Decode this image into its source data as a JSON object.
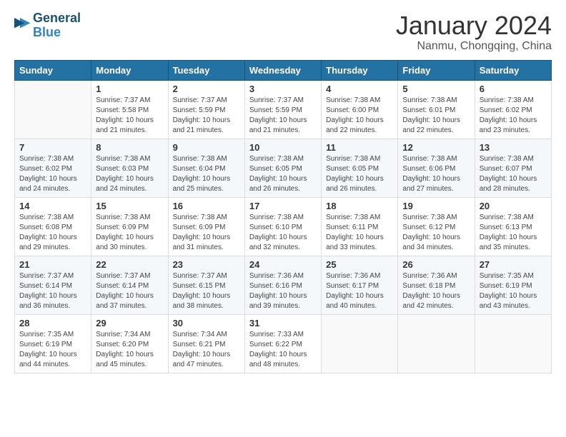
{
  "header": {
    "logo_line1": "General",
    "logo_line2": "Blue",
    "month_title": "January 2024",
    "location": "Nanmu, Chongqing, China"
  },
  "days_of_week": [
    "Sunday",
    "Monday",
    "Tuesday",
    "Wednesday",
    "Thursday",
    "Friday",
    "Saturday"
  ],
  "weeks": [
    [
      {
        "day": "",
        "info": ""
      },
      {
        "day": "1",
        "info": "Sunrise: 7:37 AM\nSunset: 5:58 PM\nDaylight: 10 hours\nand 21 minutes."
      },
      {
        "day": "2",
        "info": "Sunrise: 7:37 AM\nSunset: 5:59 PM\nDaylight: 10 hours\nand 21 minutes."
      },
      {
        "day": "3",
        "info": "Sunrise: 7:37 AM\nSunset: 5:59 PM\nDaylight: 10 hours\nand 21 minutes."
      },
      {
        "day": "4",
        "info": "Sunrise: 7:38 AM\nSunset: 6:00 PM\nDaylight: 10 hours\nand 22 minutes."
      },
      {
        "day": "5",
        "info": "Sunrise: 7:38 AM\nSunset: 6:01 PM\nDaylight: 10 hours\nand 22 minutes."
      },
      {
        "day": "6",
        "info": "Sunrise: 7:38 AM\nSunset: 6:02 PM\nDaylight: 10 hours\nand 23 minutes."
      }
    ],
    [
      {
        "day": "7",
        "info": "Sunrise: 7:38 AM\nSunset: 6:02 PM\nDaylight: 10 hours\nand 24 minutes."
      },
      {
        "day": "8",
        "info": "Sunrise: 7:38 AM\nSunset: 6:03 PM\nDaylight: 10 hours\nand 24 minutes."
      },
      {
        "day": "9",
        "info": "Sunrise: 7:38 AM\nSunset: 6:04 PM\nDaylight: 10 hours\nand 25 minutes."
      },
      {
        "day": "10",
        "info": "Sunrise: 7:38 AM\nSunset: 6:05 PM\nDaylight: 10 hours\nand 26 minutes."
      },
      {
        "day": "11",
        "info": "Sunrise: 7:38 AM\nSunset: 6:05 PM\nDaylight: 10 hours\nand 26 minutes."
      },
      {
        "day": "12",
        "info": "Sunrise: 7:38 AM\nSunset: 6:06 PM\nDaylight: 10 hours\nand 27 minutes."
      },
      {
        "day": "13",
        "info": "Sunrise: 7:38 AM\nSunset: 6:07 PM\nDaylight: 10 hours\nand 28 minutes."
      }
    ],
    [
      {
        "day": "14",
        "info": "Sunrise: 7:38 AM\nSunset: 6:08 PM\nDaylight: 10 hours\nand 29 minutes."
      },
      {
        "day": "15",
        "info": "Sunrise: 7:38 AM\nSunset: 6:09 PM\nDaylight: 10 hours\nand 30 minutes."
      },
      {
        "day": "16",
        "info": "Sunrise: 7:38 AM\nSunset: 6:09 PM\nDaylight: 10 hours\nand 31 minutes."
      },
      {
        "day": "17",
        "info": "Sunrise: 7:38 AM\nSunset: 6:10 PM\nDaylight: 10 hours\nand 32 minutes."
      },
      {
        "day": "18",
        "info": "Sunrise: 7:38 AM\nSunset: 6:11 PM\nDaylight: 10 hours\nand 33 minutes."
      },
      {
        "day": "19",
        "info": "Sunrise: 7:38 AM\nSunset: 6:12 PM\nDaylight: 10 hours\nand 34 minutes."
      },
      {
        "day": "20",
        "info": "Sunrise: 7:38 AM\nSunset: 6:13 PM\nDaylight: 10 hours\nand 35 minutes."
      }
    ],
    [
      {
        "day": "21",
        "info": "Sunrise: 7:37 AM\nSunset: 6:14 PM\nDaylight: 10 hours\nand 36 minutes."
      },
      {
        "day": "22",
        "info": "Sunrise: 7:37 AM\nSunset: 6:14 PM\nDaylight: 10 hours\nand 37 minutes."
      },
      {
        "day": "23",
        "info": "Sunrise: 7:37 AM\nSunset: 6:15 PM\nDaylight: 10 hours\nand 38 minutes."
      },
      {
        "day": "24",
        "info": "Sunrise: 7:36 AM\nSunset: 6:16 PM\nDaylight: 10 hours\nand 39 minutes."
      },
      {
        "day": "25",
        "info": "Sunrise: 7:36 AM\nSunset: 6:17 PM\nDaylight: 10 hours\nand 40 minutes."
      },
      {
        "day": "26",
        "info": "Sunrise: 7:36 AM\nSunset: 6:18 PM\nDaylight: 10 hours\nand 42 minutes."
      },
      {
        "day": "27",
        "info": "Sunrise: 7:35 AM\nSunset: 6:19 PM\nDaylight: 10 hours\nand 43 minutes."
      }
    ],
    [
      {
        "day": "28",
        "info": "Sunrise: 7:35 AM\nSunset: 6:19 PM\nDaylight: 10 hours\nand 44 minutes."
      },
      {
        "day": "29",
        "info": "Sunrise: 7:34 AM\nSunset: 6:20 PM\nDaylight: 10 hours\nand 45 minutes."
      },
      {
        "day": "30",
        "info": "Sunrise: 7:34 AM\nSunset: 6:21 PM\nDaylight: 10 hours\nand 47 minutes."
      },
      {
        "day": "31",
        "info": "Sunrise: 7:33 AM\nSunset: 6:22 PM\nDaylight: 10 hours\nand 48 minutes."
      },
      {
        "day": "",
        "info": ""
      },
      {
        "day": "",
        "info": ""
      },
      {
        "day": "",
        "info": ""
      }
    ]
  ]
}
